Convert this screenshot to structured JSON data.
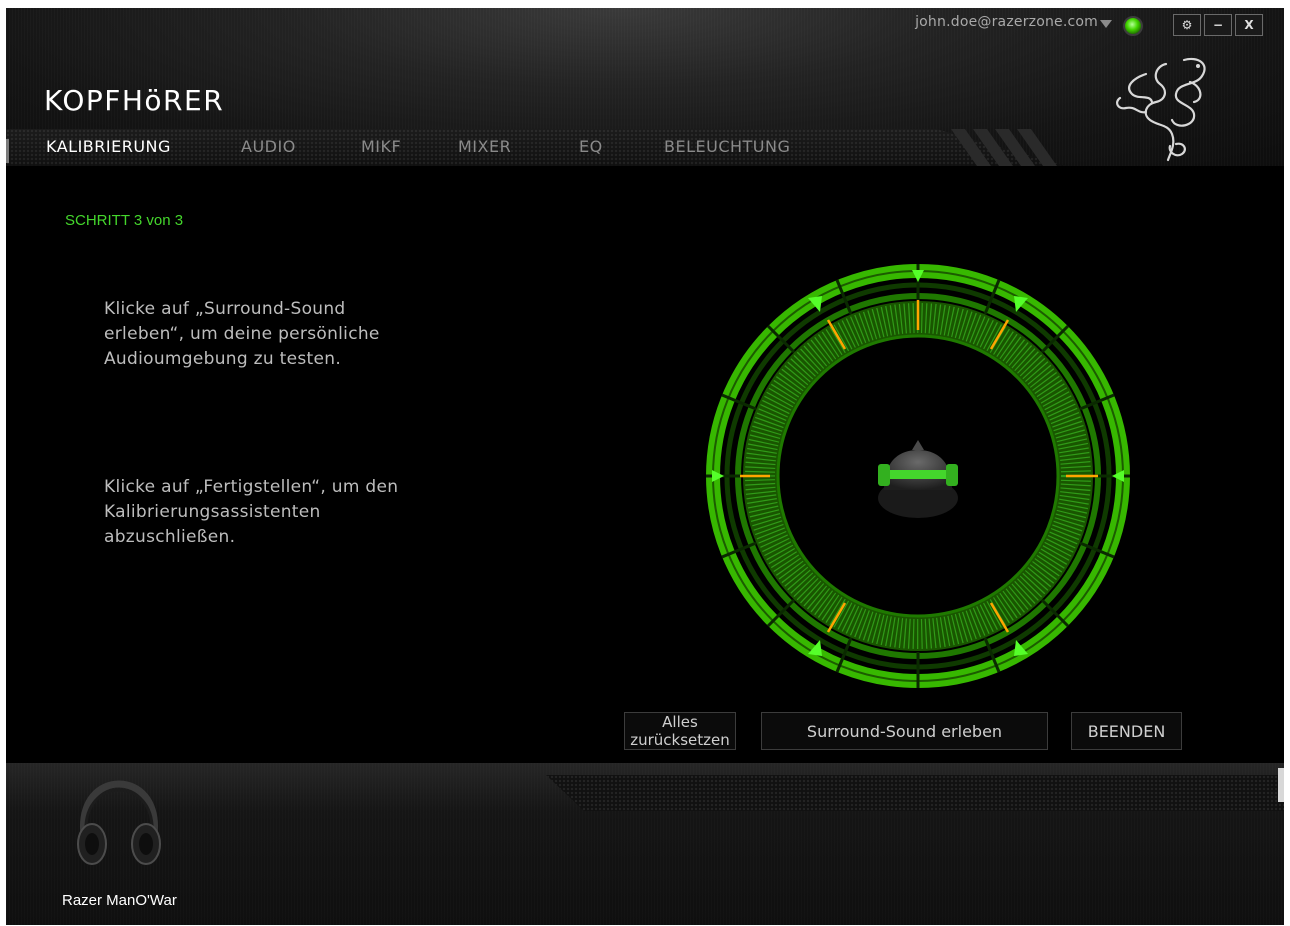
{
  "account": {
    "email": "john.doe@razerzone.com"
  },
  "window_controls": {
    "settings": "⚙",
    "minimize": "−",
    "close": "X"
  },
  "app": {
    "title": "KOPFHöRER"
  },
  "tabs": [
    {
      "label": "KALIBRIERUNG",
      "active": true
    },
    {
      "label": "AUDIO",
      "active": false
    },
    {
      "label": "MIKF",
      "active": false
    },
    {
      "label": "MIXER",
      "active": false
    },
    {
      "label": "EQ",
      "active": false
    },
    {
      "label": "BELEUCHTUNG",
      "active": false
    }
  ],
  "main": {
    "step": "SCHRITT 3 von 3",
    "instruction_1": "Klicke auf „Surround-Sound\nerleben“, um deine persönliche\nAudioumgebung zu testen.",
    "instruction_2": "Klicke auf „Fertigstellen“, um den\nKalibrierungsassistenten\nabzuschließen."
  },
  "buttons": {
    "reset": "Alles\nzurücksetzen",
    "surround": "Surround-Sound erleben",
    "finish": "BEENDEN"
  },
  "device": {
    "name": "Razer ManO'War"
  },
  "colors": {
    "accent": "#44d62c",
    "speaker_marker": "#ffa500",
    "background": "#000000"
  }
}
